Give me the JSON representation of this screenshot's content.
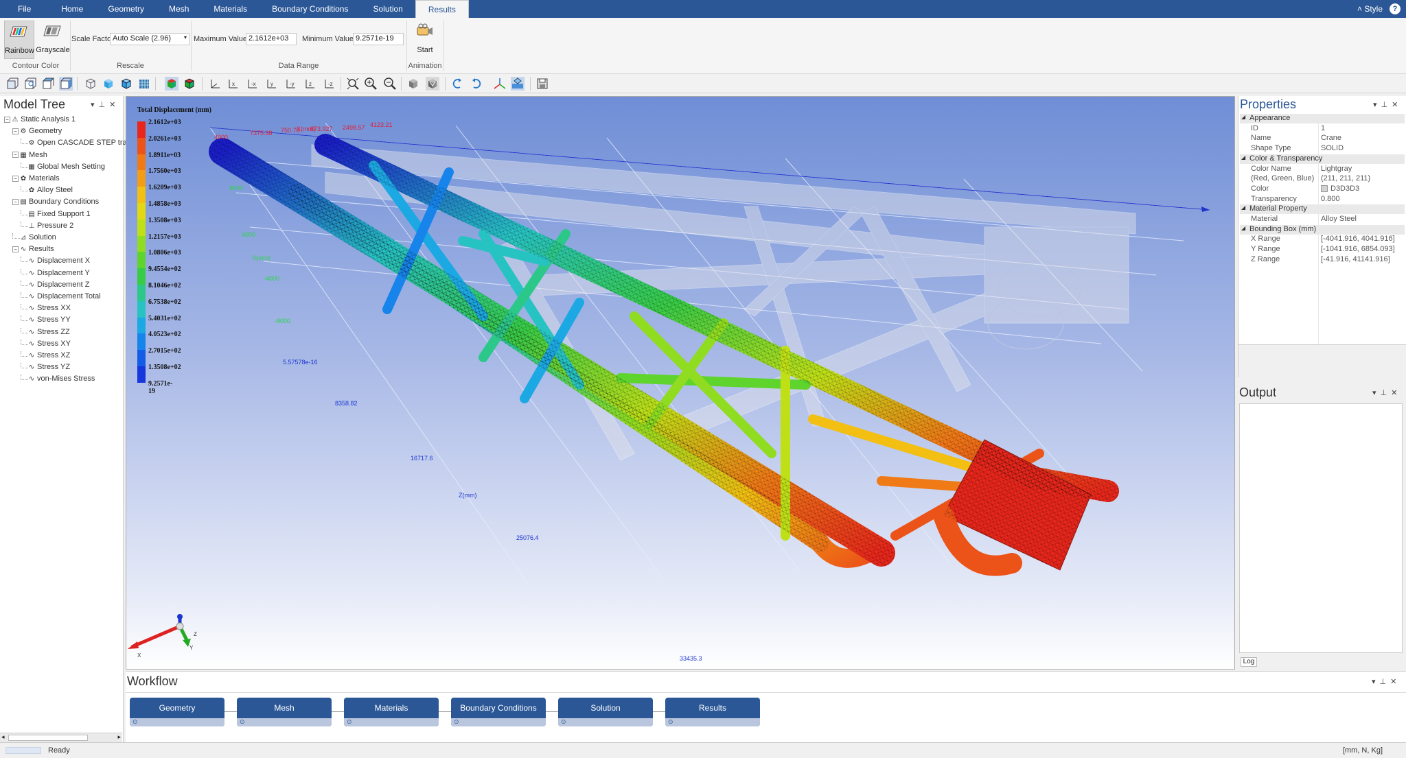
{
  "menu": {
    "tabs": [
      "File",
      "Home",
      "Geometry",
      "Mesh",
      "Materials",
      "Boundary Conditions",
      "Solution",
      "Results"
    ],
    "active_tab": "Results",
    "style_label": "Style",
    "help_label": "?"
  },
  "ribbon": {
    "rainbow_label": "Rainbow",
    "grayscale_label": "Grayscale",
    "contour_group": "Contour Color",
    "scale_factor_label": "Scale Factor",
    "scale_factor_value": "Auto Scale (2.96)",
    "rescale_group": "Rescale",
    "max_label": "Maximum Value",
    "max_value": "2.1612e+03",
    "min_label": "Minimum Value",
    "min_value": "9.2571e-19",
    "data_range_group": "Data Range",
    "start_label": "Start",
    "animation_group": "Animation"
  },
  "model_tree": {
    "title": "Model Tree",
    "items": [
      {
        "label": "Static Analysis 1",
        "level": 0,
        "icon": "analysis-icon"
      },
      {
        "label": "Geometry",
        "level": 1,
        "icon": "geometry-icon"
      },
      {
        "label": "Open CASCADE STEP tran",
        "level": 2,
        "icon": "part-icon"
      },
      {
        "label": "Mesh",
        "level": 1,
        "icon": "mesh-icon"
      },
      {
        "label": "Global Mesh Setting",
        "level": 2,
        "icon": "mesh-setting-icon"
      },
      {
        "label": "Materials",
        "level": 1,
        "icon": "materials-icon"
      },
      {
        "label": "Alloy Steel",
        "level": 2,
        "icon": "material-icon"
      },
      {
        "label": "Boundary Conditions",
        "level": 1,
        "icon": "bc-icon"
      },
      {
        "label": "Fixed Support 1",
        "level": 2,
        "icon": "fixed-support-icon"
      },
      {
        "label": "Pressure 2",
        "level": 2,
        "icon": "pressure-icon"
      },
      {
        "label": "Solution",
        "level": 1,
        "icon": "solution-icon"
      },
      {
        "label": "Results",
        "level": 1,
        "icon": "results-icon"
      },
      {
        "label": "Displacement X",
        "level": 2,
        "icon": "result-icon"
      },
      {
        "label": "Displacement Y",
        "level": 2,
        "icon": "result-icon"
      },
      {
        "label": "Displacement Z",
        "level": 2,
        "icon": "result-icon"
      },
      {
        "label": "Displacement Total",
        "level": 2,
        "icon": "result-icon"
      },
      {
        "label": "Stress XX",
        "level": 2,
        "icon": "result-icon"
      },
      {
        "label": "Stress YY",
        "level": 2,
        "icon": "result-icon"
      },
      {
        "label": "Stress ZZ",
        "level": 2,
        "icon": "result-icon"
      },
      {
        "label": "Stress XY",
        "level": 2,
        "icon": "result-icon"
      },
      {
        "label": "Stress XZ",
        "level": 2,
        "icon": "result-icon"
      },
      {
        "label": "Stress YZ",
        "level": 2,
        "icon": "result-icon"
      },
      {
        "label": "von-Mises Stress",
        "level": 2,
        "icon": "result-icon"
      }
    ]
  },
  "viewport": {
    "legend_title": "Total Displacement (mm)",
    "legend_values": [
      "2.1612e+03",
      "2.0261e+03",
      "1.8911e+03",
      "1.7560e+03",
      "1.6209e+03",
      "1.4858e+03",
      "1.3508e+03",
      "1.2157e+03",
      "1.0806e+03",
      "9.4554e+02",
      "8.1046e+02",
      "6.7538e+02",
      "5.4031e+02",
      "4.0523e+02",
      "2.7015e+02",
      "1.3508e+02",
      "9.2571e-19"
    ],
    "legend_colors": [
      "#e8261b",
      "#ec5318",
      "#ef7a16",
      "#f39c15",
      "#f2bf12",
      "#e3d812",
      "#bfe017",
      "#8fdc20",
      "#5fd42c",
      "#38cc46",
      "#2cc88a",
      "#27c3c3",
      "#1ca9e3",
      "#1684ea",
      "#145ce6",
      "#1537db",
      "#1a1ec9"
    ],
    "axis_top": [
      "4000",
      "7375.38",
      "750.78",
      "X(mm)",
      "873.927",
      "2498.57",
      "4123.21"
    ],
    "axis_left": [
      "8000",
      "4000",
      "0(mm)",
      "-4000",
      "-8000",
      "5.57578e-16"
    ],
    "axis_z": [
      "8358.82",
      "16717.6",
      "Z(mm)",
      "25076.4",
      "33435.3"
    ],
    "triad_x": "X",
    "triad_y": "Y",
    "triad_z": "Z"
  },
  "properties": {
    "title": "Properties",
    "categories": [
      {
        "name": "Appearance",
        "rows": [
          [
            "ID",
            "1"
          ],
          [
            "Name",
            "Crane"
          ],
          [
            "Shape Type",
            "SOLID"
          ]
        ]
      },
      {
        "name": "Color & Transparency",
        "rows": [
          [
            "Color Name",
            "Lightgray"
          ],
          [
            "(Red, Green, Blue)",
            "(211, 211, 211)"
          ],
          [
            "Color",
            "D3D3D3"
          ],
          [
            "Transparency",
            "0.800"
          ]
        ]
      },
      {
        "name": "Material Property",
        "rows": [
          [
            "Material",
            "Alloy Steel"
          ]
        ]
      },
      {
        "name": "Bounding Box (mm)",
        "rows": [
          [
            "X Range",
            "[-4041.916, 4041.916]"
          ],
          [
            "Y Range",
            "[-1041.916, 6854.093]"
          ],
          [
            "Z Range",
            "[-41.916, 41141.916]"
          ]
        ]
      }
    ],
    "swatch_color": "#d3d3d3"
  },
  "output": {
    "title": "Output",
    "log_tab": "Log"
  },
  "workflow": {
    "title": "Workflow",
    "steps": [
      "Geometry",
      "Mesh",
      "Materials",
      "Boundary Conditions",
      "Solution",
      "Results"
    ]
  },
  "status": {
    "ready": "Ready",
    "units": "[mm, N, Kg]"
  },
  "colors": {
    "brand": "#2b5797"
  }
}
